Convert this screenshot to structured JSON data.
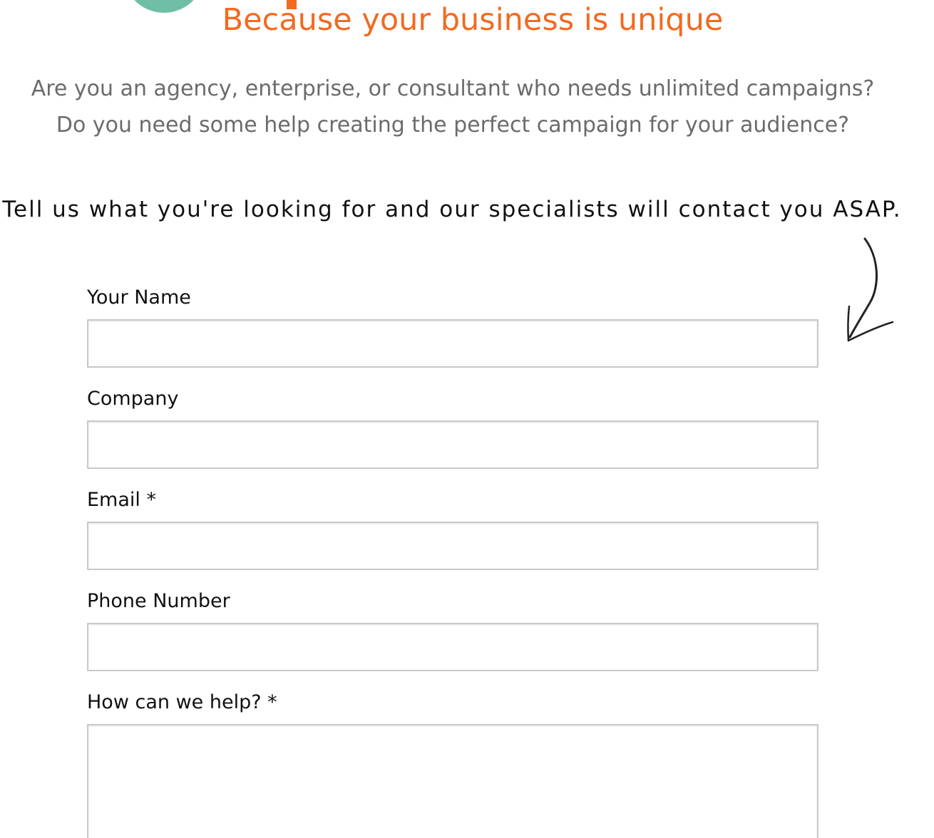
{
  "header": {
    "tagline": "Because your business is unique"
  },
  "intro": {
    "line1": "Are you an agency, enterprise, or consultant who needs unlimited campaigns?",
    "line2": "Do you need some help creating the perfect campaign for your audience?"
  },
  "cta": {
    "text": "Tell us what you're looking for and our specialists will contact you ASAP."
  },
  "form": {
    "name": {
      "label": "Your Name",
      "value": ""
    },
    "company": {
      "label": "Company",
      "value": ""
    },
    "email": {
      "label": "Email *",
      "value": ""
    },
    "phone": {
      "label": "Phone Number",
      "value": ""
    },
    "help": {
      "label": "How can we help? *",
      "value": ""
    }
  },
  "colors": {
    "accent": "#f26a21",
    "teal": "#6fbea6",
    "intro_text": "#6b6b6b"
  },
  "icons": {
    "arrow": "hand-drawn-arrow-icon"
  }
}
